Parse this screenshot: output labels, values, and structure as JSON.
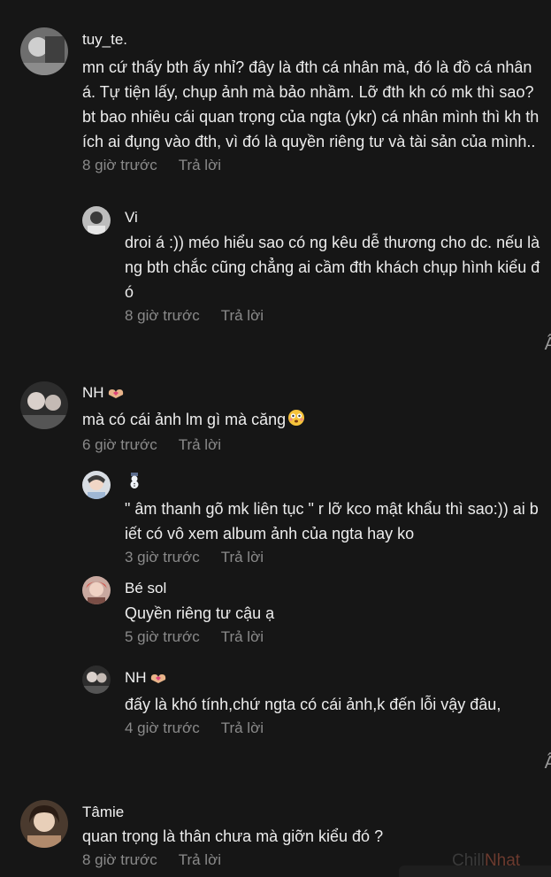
{
  "comments": [
    {
      "author": "tuy_te.",
      "text": "mn cứ thấy bth ấy nhỉ? đây là đth cá nhân mà, đó là đồ cá nhân á. Tự tiện lấy, chụp ảnh mà bảo nhầm. Lỡ đth kh có mk thì sao? bt bao nhiêu cái quan trọng của ngta (ykr) cá nhân mình thì kh thích ai đụng vào đth, vì đó là quyền riêng tư và tài sản của mình..",
      "time": "8 giờ trước",
      "reply_label": "Trả lời",
      "replies": [
        {
          "author": "Vi",
          "text": "droi á :)) méo hiểu sao có ng kêu dễ thương cho dc. nếu là ng bth chắc cũng chẳng ai cầm đth khách chụp hình kiểu đó",
          "time": "8 giờ trước",
          "reply_label": "Trả lời"
        }
      ]
    },
    {
      "author": "NH",
      "author_emoji": "heart-hands-icon",
      "text": "mà có cái ảnh lm gì mà căng",
      "text_emoji": "flushed-face-icon",
      "time": "6 giờ trước",
      "reply_label": "Trả lời",
      "replies": [
        {
          "author": "",
          "author_emoji": "snowman-icon",
          "text": "\" âm thanh gõ mk liên tục \" r lỡ kco mật khẩu thì sao:)) ai biết có vô xem album ảnh của ngta hay ko",
          "time": "3 giờ trước",
          "reply_label": "Trả lời"
        },
        {
          "author": "Bé sol",
          "text": "Quyền riêng tư cậu ạ",
          "time": "5 giờ trước",
          "reply_label": "Trả lời"
        },
        {
          "author": "NH",
          "author_emoji": "heart-hands-icon",
          "text": "đấy là khó tính,chứ ngta có cái ảnh,k đến lỗi vậy đâu,",
          "time": "4 giờ trước",
          "reply_label": "Trả lời"
        }
      ]
    },
    {
      "author": "Tâmie",
      "text": "quan trọng là thân chưa mà giỡn kiểu đó ?",
      "time": "8 giờ trước",
      "reply_label": "Trả lời",
      "replies": []
    }
  ],
  "edge_glyph": "Ẩ",
  "watermark": {
    "part1": "Chill",
    "part2": "Nhat"
  },
  "colors": {
    "background": "#161616",
    "text": "#ececec",
    "meta": "#8a8a8a"
  }
}
